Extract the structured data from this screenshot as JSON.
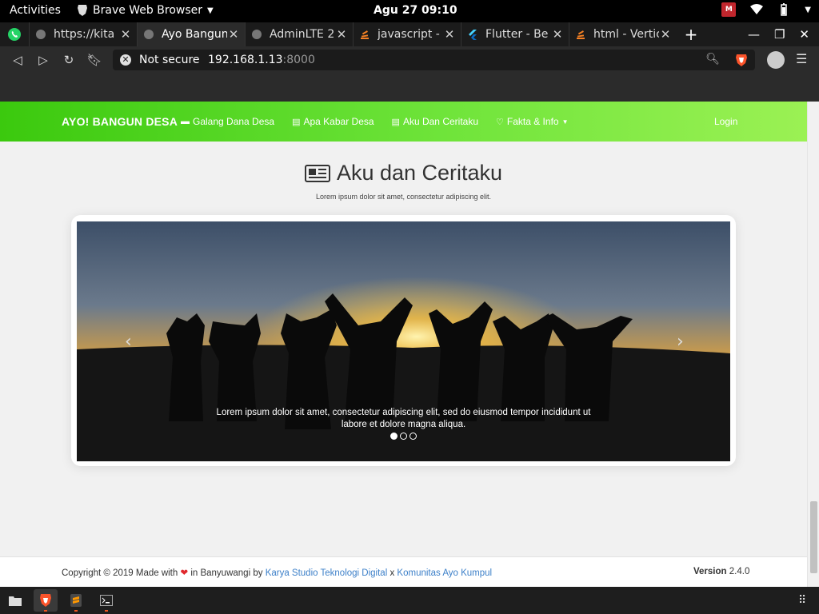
{
  "topbar": {
    "activities": "Activities",
    "app_name": "Brave Web Browser",
    "clock": "Agu 27  09:10"
  },
  "tabs": [
    {
      "title": "https://kita",
      "icon": "globe-icon"
    },
    {
      "title": "Ayo Bangun",
      "icon": "globe-icon",
      "active": true
    },
    {
      "title": "AdminLTE 2",
      "icon": "globe-icon"
    },
    {
      "title": "javascript -",
      "icon": "stackoverflow-icon"
    },
    {
      "title": "Flutter - Be",
      "icon": "flutter-icon"
    },
    {
      "title": "html - Vertic",
      "icon": "stackoverflow-icon"
    }
  ],
  "addressbar": {
    "security": "Not secure",
    "host": "192.168.1.13",
    "port": ":8000"
  },
  "site": {
    "brand": "AYO! BANGUN DESA",
    "nav": [
      {
        "label": "Galang Dana Desa",
        "icon": "archive-icon"
      },
      {
        "label": "Apa Kabar Desa",
        "icon": "newspaper-icon"
      },
      {
        "label": "Aku Dan Ceritaku",
        "icon": "newspaper-icon"
      },
      {
        "label": "Fakta & Info",
        "icon": "heart-icon",
        "dropdown": true
      }
    ],
    "login": "Login"
  },
  "section": {
    "title": "Aku dan Ceritaku",
    "subtitle": "Lorem ipsum dolor sit amet, consectetur adipiscing elit."
  },
  "carousel": {
    "caption": "Lorem ipsum dolor sit amet, consectetur adipiscing elit, sed do eiusmod tempor incididunt ut labore et dolore magna aliqua.",
    "indicator_count": 3,
    "active_index": 0
  },
  "footer": {
    "copyright_pre": "Copyright © 2019 Made with",
    "heart": "❤",
    "copyright_mid": "in Banyuwangi by",
    "link1": "Karya Studio Teknologi Digital",
    "sep": "x",
    "link2": "Komunitas Ayo Kumpul",
    "version_label": "Version",
    "version": "2.4.0"
  },
  "colors": {
    "nav_gradient_start": "#3bc90e",
    "nav_gradient_end": "#9bf154",
    "link": "#3d80c9",
    "heart": "#e0282d"
  }
}
